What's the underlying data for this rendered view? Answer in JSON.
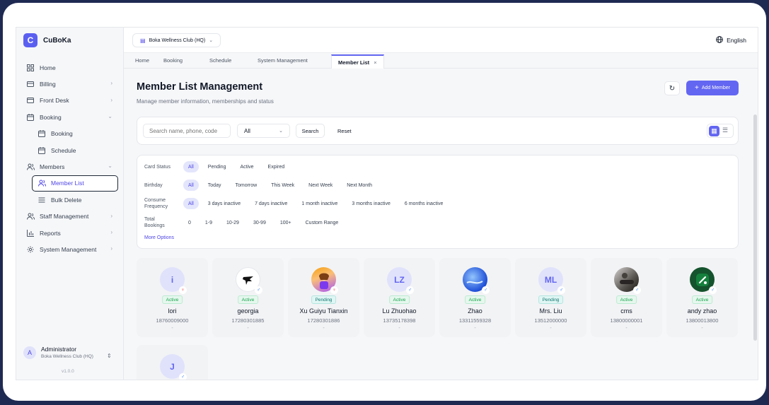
{
  "brand": {
    "logo": "C",
    "name": "CuBoKa"
  },
  "header": {
    "club": "Boka Wellness Club (HQ)",
    "language": "English"
  },
  "tabs": [
    {
      "label": "Home"
    },
    {
      "label": "Booking"
    },
    {
      "label": "Schedule"
    },
    {
      "label": "System Management"
    },
    {
      "label": "Member List",
      "close": "×"
    }
  ],
  "sidebar": {
    "items": [
      {
        "label": "Home",
        "icon": "grid-icon"
      },
      {
        "label": "Billing",
        "icon": "card-icon",
        "chevron": "›"
      },
      {
        "label": "Front Desk",
        "icon": "desk-icon",
        "chevron": "›"
      },
      {
        "label": "Booking",
        "icon": "calendar-icon",
        "chevron": "⌄"
      },
      {
        "label": "Booking",
        "icon": "calendar-icon"
      },
      {
        "label": "Schedule",
        "icon": "calendar-icon"
      },
      {
        "label": "Members",
        "icon": "users-icon",
        "chevron": "⌄"
      },
      {
        "label": "Member List",
        "icon": "users-icon"
      },
      {
        "label": "Bulk Delete",
        "icon": "list-icon"
      },
      {
        "label": "Staff Management",
        "icon": "staff-icon",
        "chevron": "›"
      },
      {
        "label": "Reports",
        "icon": "chart-icon",
        "chevron": "›"
      },
      {
        "label": "System Management",
        "icon": "gear-icon",
        "chevron": "›"
      }
    ],
    "user": {
      "initial": "A",
      "name": "Administrator",
      "org": "Boka Wellness Club (HQ)",
      "version": "v1.0.0"
    }
  },
  "main": {
    "title": "Member List Management",
    "subtitle": "Manage member information, memberships and status",
    "add_button": "Add Member",
    "search": {
      "placeholder": "Search name, phone, code",
      "status_value": "All",
      "search_label": "Search",
      "reset_label": "Reset"
    },
    "filters": {
      "card_status": {
        "label": "Card Status",
        "options": [
          "All",
          "Pending",
          "Active",
          "Expired"
        ]
      },
      "birthday": {
        "label": "Birthday",
        "options": [
          "All",
          "Today",
          "Tomorrow",
          "This Week",
          "Next Week",
          "Next Month"
        ]
      },
      "frequency": {
        "label_1": "Consume",
        "label_2": "Frequency",
        "options": [
          "All",
          "3 days inactive",
          "7 days inactive",
          "1 month inactive",
          "3 months inactive",
          "6 months inactive"
        ]
      },
      "bookings": {
        "label_1": "Total",
        "label_2": "Bookings",
        "options": [
          "0",
          "1-9",
          "10-29",
          "30-99",
          "100+",
          "Custom Range"
        ]
      },
      "more": "More Options"
    },
    "members": [
      {
        "initials": "i",
        "gender": "♀",
        "status": "Active",
        "name": "lori",
        "phone": "18760009000",
        "extra": "-"
      },
      {
        "initials": "",
        "gender": "♂",
        "status": "Active",
        "name": "georgia",
        "phone": "17280301885",
        "extra": "-"
      },
      {
        "initials": "",
        "gender": "♀",
        "status": "Pending",
        "name": "Xu Guiyu Tianxin",
        "phone": "17280301886",
        "extra": "-"
      },
      {
        "initials": "LZ",
        "gender": "♂",
        "status": "Active",
        "name": "Lu Zhuohao",
        "phone": "13735178398",
        "extra": "-"
      },
      {
        "initials": "",
        "gender": "♂",
        "status": "Active",
        "name": "Zhao",
        "phone": "13311559328",
        "extra": "-"
      },
      {
        "initials": "ML",
        "gender": "♂",
        "status": "Pending",
        "name": "Mrs. Liu",
        "phone": "13512000000",
        "extra": "-"
      },
      {
        "initials": "",
        "gender": "♂",
        "status": "Active",
        "name": "cms",
        "phone": "13800000001",
        "extra": "-"
      },
      {
        "initials": "",
        "gender": "♂",
        "status": "Active",
        "name": "andy zhao",
        "phone": "13800013800",
        "extra": "-"
      },
      {
        "initials": "J",
        "gender": "♂"
      }
    ]
  }
}
